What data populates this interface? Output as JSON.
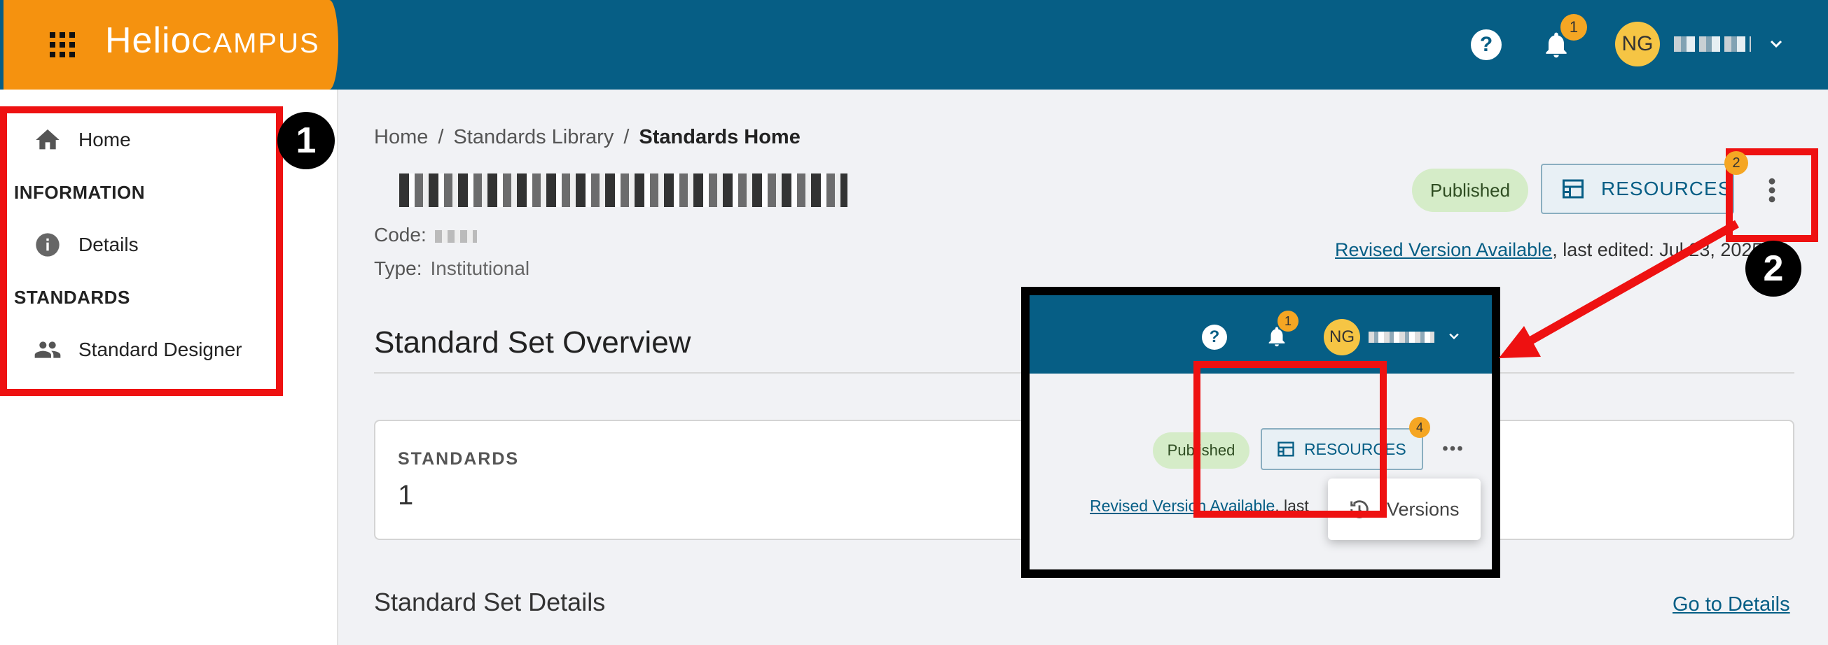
{
  "header": {
    "logo_part1": "Helio",
    "logo_part2": "CAMPUS",
    "help_label": "?",
    "notification_count": "1",
    "avatar_initials": "NG"
  },
  "sidebar": {
    "home": "Home",
    "section_information": "INFORMATION",
    "details": "Details",
    "section_standards": "STANDARDS",
    "standard_designer": "Standard Designer"
  },
  "annotations": {
    "step1": "1",
    "step2": "2"
  },
  "breadcrumb": {
    "items": [
      "Home",
      "Standards Library",
      "Standards Home"
    ],
    "separator": "/"
  },
  "meta": {
    "code_label": "Code:",
    "type_label": "Type:",
    "type_value": "Institutional"
  },
  "status": {
    "badge": "Published",
    "resources_button": "RESOURCES",
    "resources_badge": "2",
    "revised_link": "Revised Version Available",
    "revised_suffix": ", last edited: Jul 23, 2025"
  },
  "overview": {
    "title": "Standard Set Overview",
    "card_label": "STANDARDS",
    "card_value": "1"
  },
  "details": {
    "title": "Standard Set Details",
    "link": "Go to Details"
  },
  "inset": {
    "notification_count": "1",
    "avatar_initials": "NG",
    "badge": "Published",
    "resources_button": "RESOURCES",
    "resources_badge": "4",
    "revised_link": "Revised Version Available",
    "revised_suffix": ", last",
    "menu_item": "Versions"
  },
  "colors": {
    "header_bg": "#065e85",
    "logo_bg": "#f5920f",
    "badge_bg": "#f5a623",
    "published_bg": "#d5ecc8",
    "annotation_red": "#ee1111"
  }
}
